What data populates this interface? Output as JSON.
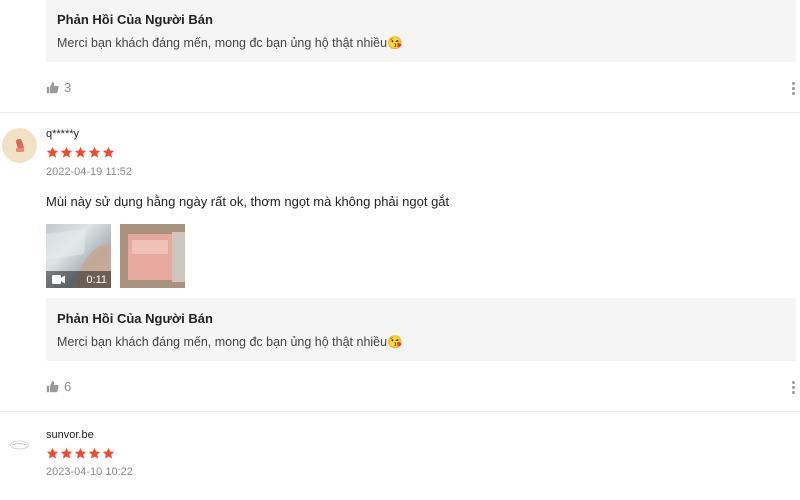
{
  "reviews": [
    {
      "seller_reply": {
        "title": "Phản Hồi Của Người Bán",
        "text": "Merci bạn khách đáng mến, mong đc bạn ủng hộ thật nhiều😘"
      },
      "likes": "3"
    },
    {
      "username": "q*****y",
      "rating": 5,
      "date": "2022-04-19 11:52",
      "text": "Mùi này sử dụng hằng ngày rất ok, thơm ngọt mà không phải ngọt gắt",
      "video_duration": "0:11",
      "seller_reply": {
        "title": "Phản Hồi Của Người Bán",
        "text": "Merci bạn khách đáng mến, mong đc bạn ủng hộ thật nhiều😘"
      },
      "likes": "6"
    },
    {
      "username": "sunvor.be",
      "rating": 5,
      "date": "2023-04-10 10:22"
    }
  ],
  "colors": {
    "star": "#ee4d2d",
    "reply_bg": "#f5f5f5",
    "muted": "#8a8a8a"
  },
  "icons": [
    "thumbs-up-icon",
    "more-vertical-icon",
    "video-camera-icon",
    "star-icon"
  ]
}
